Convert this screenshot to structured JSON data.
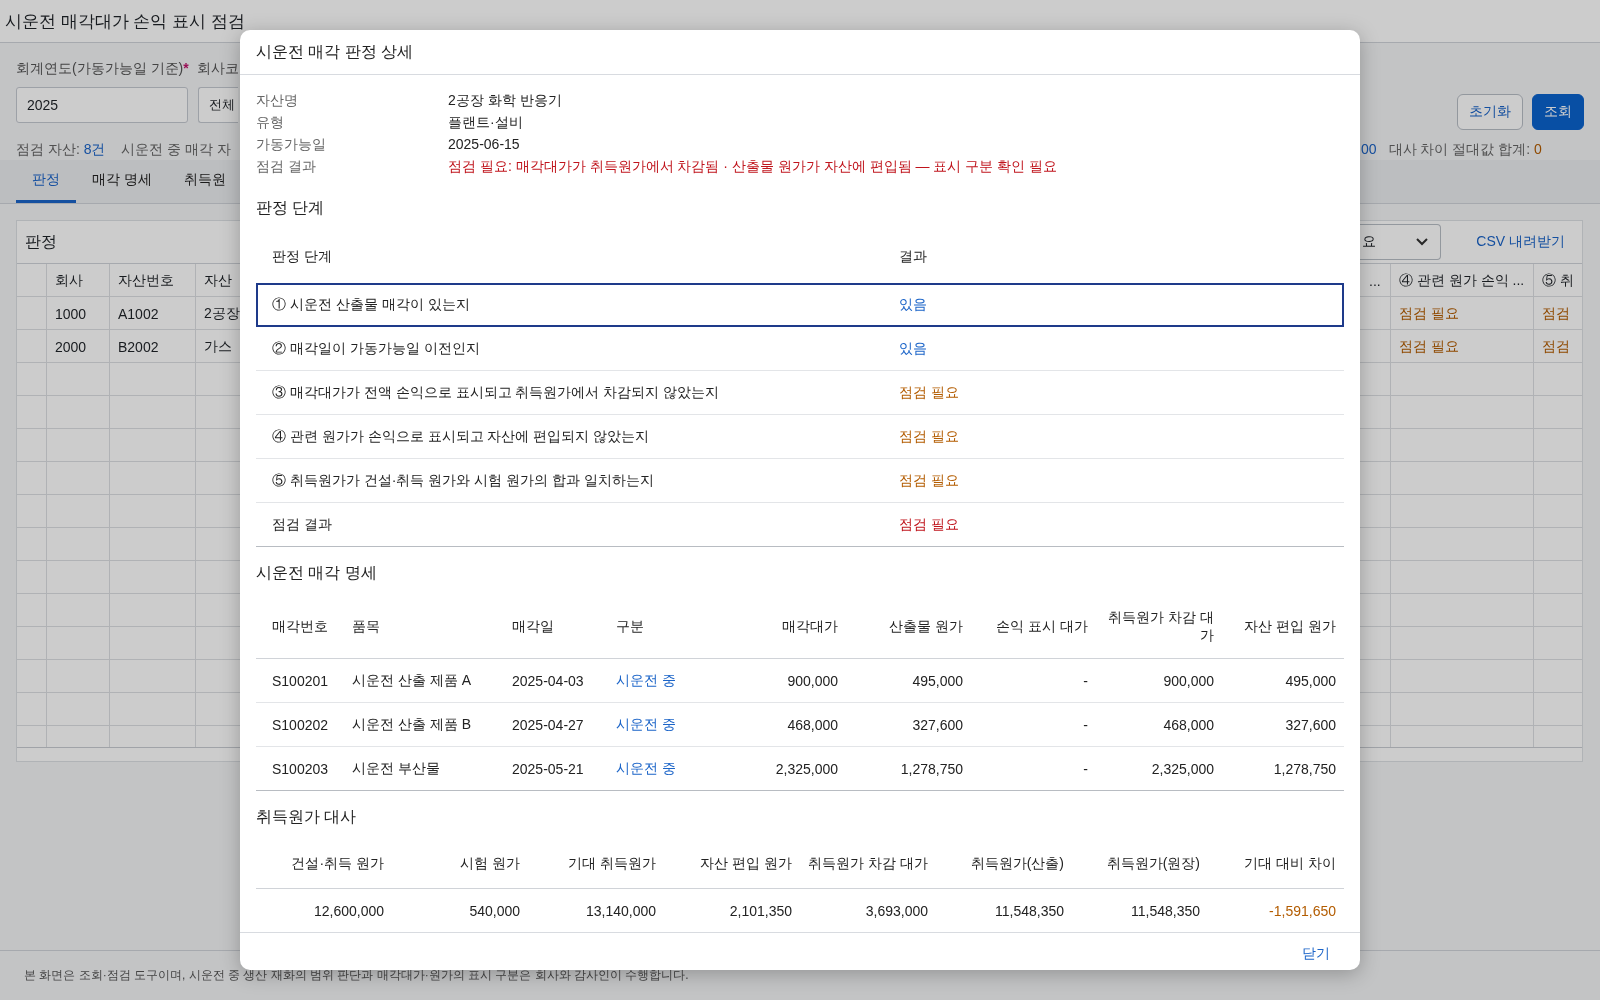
{
  "page": {
    "title": "시운전 매각대가 손익 표시 점검",
    "filters": {
      "year_label": "회계연도(가동가능일 기준)",
      "required_mark": "*",
      "company_label": "회사코",
      "year_value": "2025",
      "company_value": "전체"
    },
    "buttons": [
      {
        "label": "초기화",
        "kind": "secondary"
      },
      {
        "label": "조회",
        "kind": "primary"
      }
    ],
    "summary_left": [
      {
        "label": "점검 자산:",
        "value": "8건"
      },
      {
        "label": "시운전 중 매각 자"
      }
    ],
    "summary_right": [
      {
        "value": "00",
        "kind": "count"
      },
      {
        "label": "대사 차이 절대값 합계:",
        "value": "0",
        "kind": "diff"
      }
    ],
    "tabs": [
      {
        "label": "판정",
        "selected": true
      },
      {
        "label": "매각 명세",
        "selected": false
      },
      {
        "label": "취득원",
        "selected": false
      }
    ],
    "panel": {
      "title": "판정",
      "filter_value": "요",
      "csv_button": "CSV 내려받기",
      "columns_left": [
        "회사",
        "자산번호",
        "자산"
      ],
      "columns_right": [
        "...",
        "④ 관련 원가 손익 ...",
        "⑤ 취"
      ],
      "rows": [
        {
          "company": "1000",
          "asset_no": "A1002",
          "asset_name": "2공장",
          "check_4": "점검 필요",
          "check_5": "점검"
        },
        {
          "company": "2000",
          "asset_no": "B2002",
          "asset_name": "가스",
          "check_4": "점검 필요",
          "check_5": "점검"
        }
      ]
    },
    "footer_note": "본 화면은 조회·점검 도구이며, 시운전 중 생산 재화의 범위 판단과 매각대가·원가의 표시 구분은 회사와 감사인이 수행합니다."
  },
  "detail": {
    "title": "시운전 매각 판정 상세",
    "fields": [
      {
        "label": "자산명",
        "value": "2공장 화학 반응기",
        "kind": "plain"
      },
      {
        "label": "유형",
        "value": "플랜트·설비",
        "kind": "plain"
      },
      {
        "label": "가동가능일",
        "value": "2025-06-15",
        "kind": "plain"
      },
      {
        "label": "점검 결과",
        "value": "점검 필요: 매각대가가 취득원가에서 차감됨 · 산출물 원가가 자산에 편입됨 — 표시 구분 확인 필요",
        "kind": "alert"
      }
    ],
    "steps": {
      "title": "판정 단계",
      "columns": [
        "판정 단계",
        "결과"
      ],
      "rows": [
        {
          "step": "① 시운전 산출물 매각이 있는지",
          "result": "있음",
          "kind": "ok",
          "selected": true
        },
        {
          "step": "② 매각일이 가동가능일 이전인지",
          "result": "있음",
          "kind": "ok",
          "selected": false
        },
        {
          "step": "③ 매각대가가 전액 손익으로 표시되고 취득원가에서 차감되지 않았는지",
          "result": "점검 필요",
          "kind": "warn",
          "selected": false
        },
        {
          "step": "④ 관련 원가가 손익으로 표시되고 자산에 편입되지 않았는지",
          "result": "점검 필요",
          "kind": "warn",
          "selected": false
        },
        {
          "step": "⑤ 취득원가가 건설·취득 원가와 시험 원가의 합과 일치하는지",
          "result": "점검 필요",
          "kind": "warn",
          "selected": false
        },
        {
          "step": "점검 결과",
          "result": "점검 필요",
          "kind": "fail",
          "selected": false
        }
      ]
    },
    "sales": {
      "title": "시운전 매각 명세",
      "columns": [
        {
          "label": "매각번호",
          "kind": "text"
        },
        {
          "label": "품목",
          "kind": "text"
        },
        {
          "label": "매각일",
          "kind": "text"
        },
        {
          "label": "구분",
          "kind": "status"
        },
        {
          "label": "매각대가",
          "kind": "amount"
        },
        {
          "label": "산출물 원가",
          "kind": "amount"
        },
        {
          "label": "손익 표시 대가",
          "kind": "amount"
        },
        {
          "label": "취득원가 차감 대가",
          "kind": "amount"
        },
        {
          "label": "자산 편입 원가",
          "kind": "amount"
        }
      ],
      "rows": [
        [
          "S100201",
          "시운전 산출 제품 A",
          "2025-04-03",
          "시운전 중",
          "900,000",
          "495,000",
          "-",
          "900,000",
          "495,000"
        ],
        [
          "S100202",
          "시운전 산출 제품 B",
          "2025-04-27",
          "시운전 중",
          "468,000",
          "327,600",
          "-",
          "468,000",
          "327,600"
        ],
        [
          "S100203",
          "시운전 부산물",
          "2025-05-21",
          "시운전 중",
          "2,325,000",
          "1,278,750",
          "-",
          "2,325,000",
          "1,278,750"
        ]
      ]
    },
    "reconciliation": {
      "title": "취득원가 대사",
      "columns": [
        "건설·취득 원가",
        "시험 원가",
        "기대 취득원가",
        "자산 편입 원가",
        "취득원가 차감 대가",
        "취득원가(산출)",
        "취득원가(원장)",
        "기대 대비 차이"
      ],
      "row": [
        {
          "value": "12,600,000",
          "kind": "plain"
        },
        {
          "value": "540,000",
          "kind": "plain"
        },
        {
          "value": "13,140,000",
          "kind": "plain"
        },
        {
          "value": "2,101,350",
          "kind": "plain"
        },
        {
          "value": "3,693,000",
          "kind": "plain"
        },
        {
          "value": "11,548,350",
          "kind": "plain"
        },
        {
          "value": "11,548,350",
          "kind": "plain"
        },
        {
          "value": "-1,591,650",
          "kind": "warn"
        }
      ]
    },
    "close_button": "닫기"
  }
}
